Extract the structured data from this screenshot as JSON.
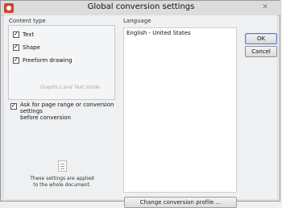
{
  "window": {
    "title": "Global conversion settings"
  },
  "content_type": {
    "label": "Content type",
    "options": [
      {
        "label": "Text",
        "checked": true
      },
      {
        "label": "Shape",
        "checked": true
      },
      {
        "label": "Freeform drawing",
        "checked": true
      }
    ],
    "hint": "Graphics and Text inside"
  },
  "ask_option": {
    "line1": "Ask for page range or conversion settings",
    "line2": "before conversion",
    "checked": true
  },
  "language": {
    "label": "Language",
    "items": [
      "English - United States"
    ]
  },
  "buttons": {
    "ok": "OK",
    "cancel": "Cancel",
    "change_profile": "Change conversion profile ..."
  },
  "note": {
    "line1": "These settings are applied",
    "line2": "to the whole document."
  },
  "icons": {
    "app": "app-icon",
    "close": "close-icon",
    "document": "document-icon"
  }
}
